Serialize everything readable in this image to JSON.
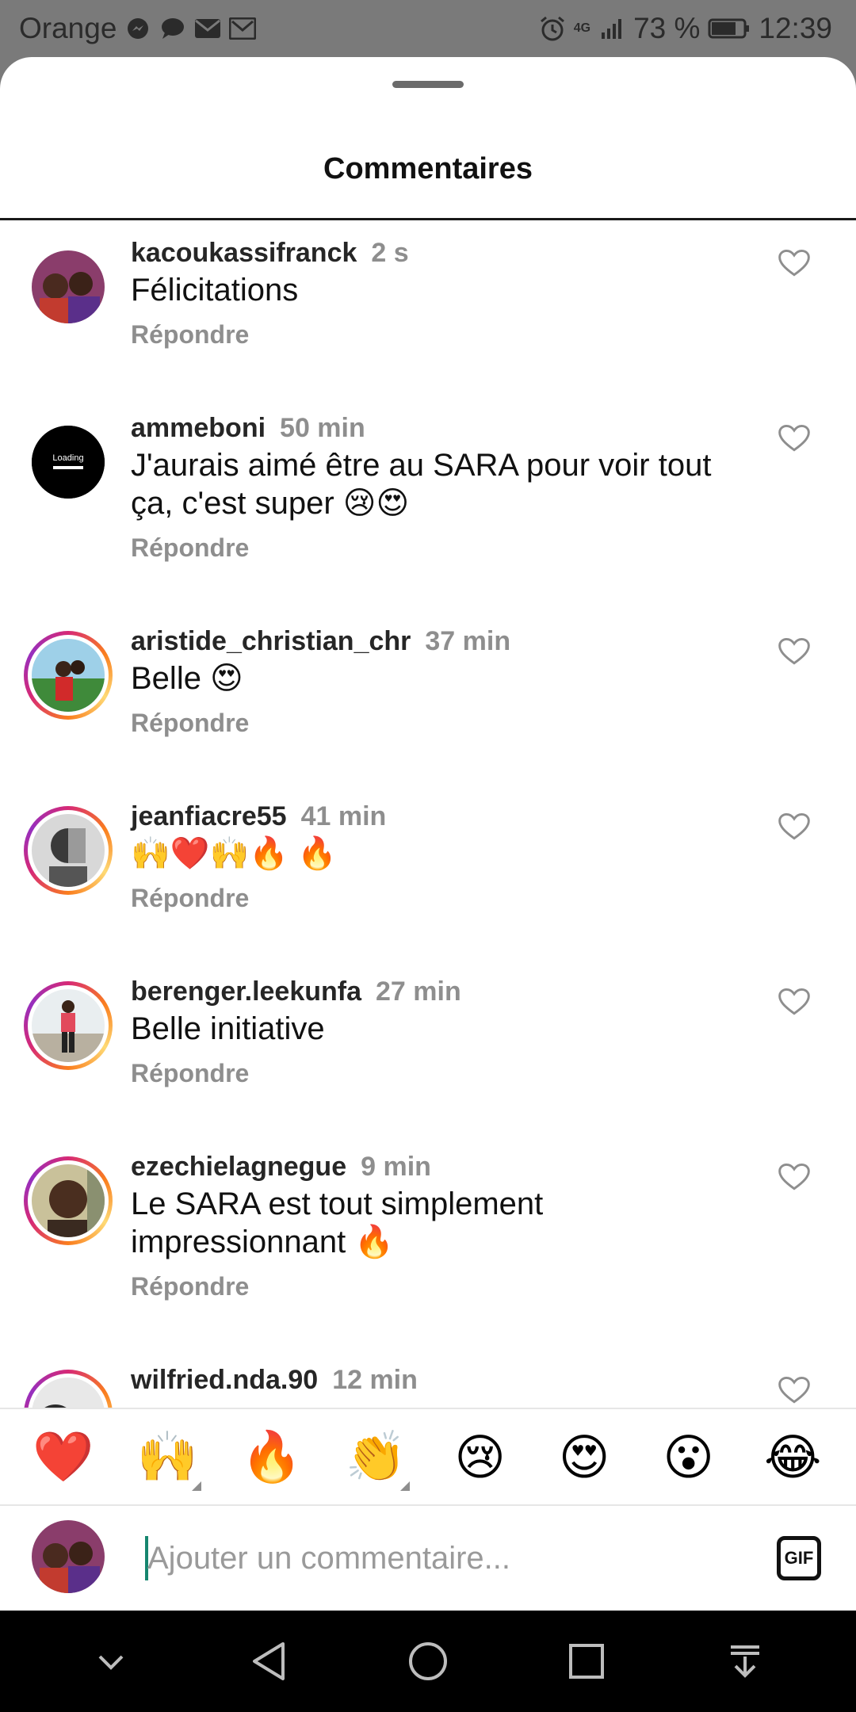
{
  "status_bar": {
    "carrier": "Orange",
    "network": "4G",
    "battery": "73 %",
    "time": "12:39",
    "left_icons": [
      "messenger-icon",
      "chat-bubble-icon",
      "mail-icon",
      "gmail-icon"
    ],
    "right_icons": [
      "alarm-icon",
      "signal-icon",
      "battery-icon"
    ]
  },
  "sheet": {
    "title": "Commentaires"
  },
  "comments": [
    {
      "username": "kacoukassifranck",
      "time": "2 s",
      "text": "Félicitations",
      "reply": "Répondre"
    },
    {
      "username": "ammeboni",
      "time": "50 min",
      "text": "J'aurais aimé être au SARA pour voir tout ça, c'est super 😢😍",
      "reply": "Répondre",
      "avatar_label": "Loading"
    },
    {
      "username": "aristide_christian_chr",
      "time": "37 min",
      "text": "Belle 😍",
      "reply": "Répondre"
    },
    {
      "username": "jeanfiacre55",
      "time": "41 min",
      "text": "🙌❤️🙌🔥 🔥",
      "reply": "Répondre"
    },
    {
      "username": "berenger.leekunfa",
      "time": "27 min",
      "text": "Belle initiative",
      "reply": "Répondre"
    },
    {
      "username": "ezechielagnegue",
      "time": "9 min",
      "text": "Le SARA est tout simplement impressionnant 🔥",
      "reply": "Répondre"
    },
    {
      "username": "wilfried.nda.90",
      "time": "12 min",
      "text": "",
      "reply": ""
    }
  ],
  "emoji_bar": [
    "❤️",
    "🙌",
    "🔥",
    "👏",
    "😢",
    "😍",
    "😮",
    "😂"
  ],
  "comment_box": {
    "placeholder": "Ajouter un commentaire...",
    "gif_label": "GIF"
  },
  "nav_bar": [
    "chevron-down-icon",
    "back-icon",
    "home-icon",
    "recents-icon",
    "download-icon"
  ],
  "colors": {
    "accent_ring_start": "#d62976",
    "accent_ring_end": "#fa7e1e",
    "muted": "#8e8e8e",
    "caret": "#16866f"
  }
}
